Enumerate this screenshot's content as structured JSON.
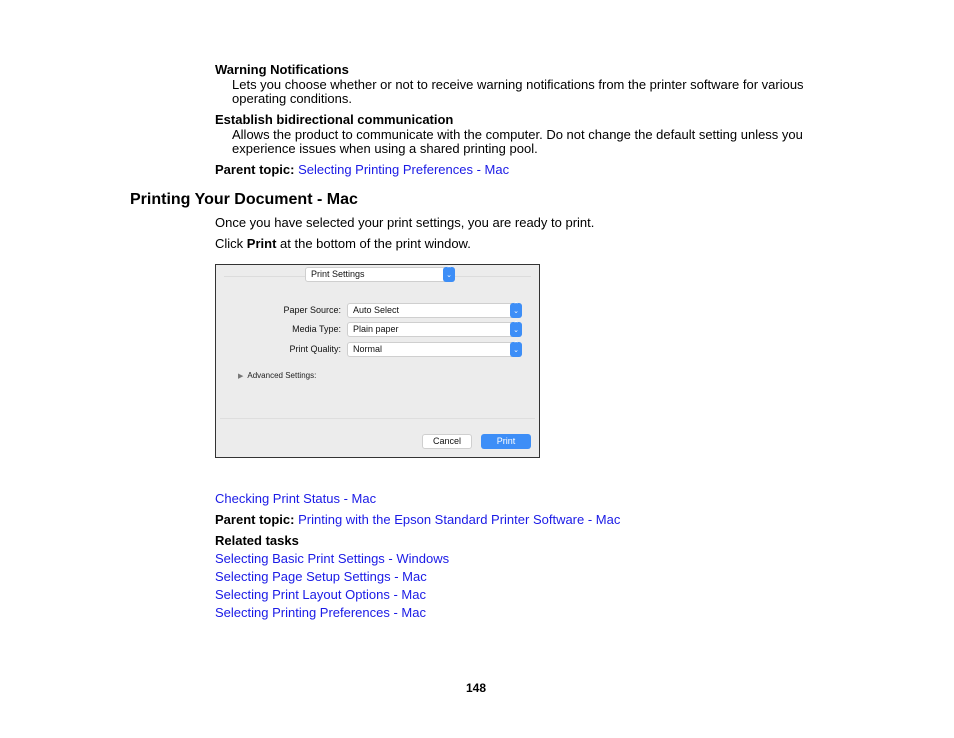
{
  "sections": {
    "warning": {
      "title": "Warning Notifications",
      "text_line1": "Lets you choose whether or not to receive warning notifications from the printer software for various",
      "text_line2": "operating conditions."
    },
    "bidirectional": {
      "title": "Establish bidirectional communication",
      "text_line1": "Allows the product to communicate with the computer. Do not change the default setting unless you",
      "text_line2": "experience issues when using a shared printing pool."
    },
    "parent_topic_1": {
      "label": "Parent topic:",
      "link": "Selecting Printing Preferences - Mac"
    }
  },
  "heading": "Printing Your Document - Mac",
  "intro": "Once you have selected your print settings, you are ready to print.",
  "instruction": {
    "prefix": "Click",
    "bold": "Print",
    "suffix": "at the bottom of the print window."
  },
  "dialog": {
    "panel_select": "Print Settings",
    "fields": [
      {
        "label": "Paper Source:",
        "value": "Auto Select"
      },
      {
        "label": "Media Type:",
        "value": "Plain paper"
      },
      {
        "label": "Print Quality:",
        "value": "Normal"
      }
    ],
    "advanced_label": "Advanced Settings:",
    "cancel_label": "Cancel",
    "print_label": "Print"
  },
  "subtopic_link": "Checking Print Status - Mac",
  "parent_topic_2": {
    "label": "Parent topic:",
    "link": "Printing with the Epson Standard Printer Software - Mac"
  },
  "related_tasks": {
    "title": "Related tasks",
    "links": [
      "Selecting Basic Print Settings - Windows",
      "Selecting Page Setup Settings - Mac",
      "Selecting Print Layout Options - Mac",
      "Selecting Printing Preferences - Mac"
    ]
  },
  "page_number": "148"
}
